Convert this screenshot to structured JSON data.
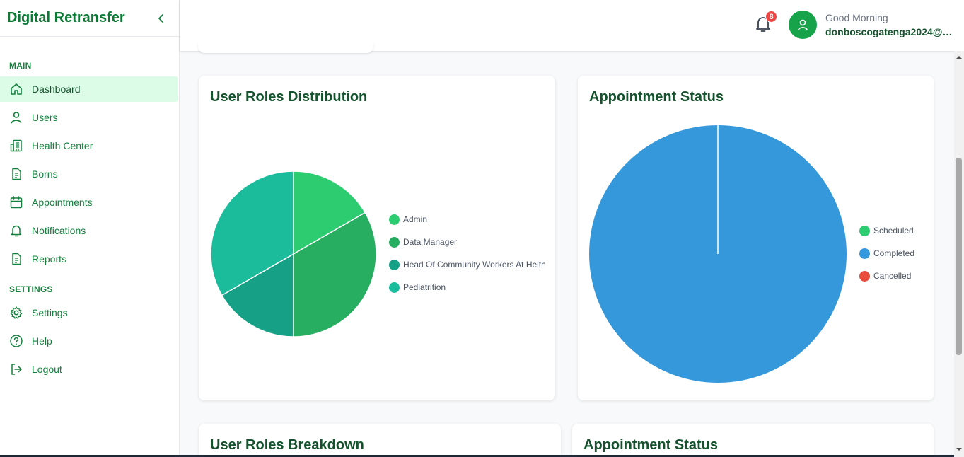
{
  "app": {
    "title": "Digital Retransfer"
  },
  "sidebar": {
    "sections": {
      "main": "MAIN",
      "settings": "SETTINGS"
    },
    "items": [
      {
        "label": "Dashboard",
        "icon": "home-icon"
      },
      {
        "label": "Users",
        "icon": "user-icon"
      },
      {
        "label": "Health Center",
        "icon": "building-icon"
      },
      {
        "label": "Borns",
        "icon": "document-icon"
      },
      {
        "label": "Appointments",
        "icon": "calendar-icon"
      },
      {
        "label": "Notifications",
        "icon": "bell-icon"
      },
      {
        "label": "Reports",
        "icon": "document-icon"
      }
    ],
    "settings_items": [
      {
        "label": "Settings",
        "icon": "gear-icon"
      },
      {
        "label": "Help",
        "icon": "help-circle-icon"
      },
      {
        "label": "Logout",
        "icon": "logout-icon"
      }
    ]
  },
  "header": {
    "notification_count": "8",
    "greeting": "Good Morning",
    "user_email": "donboscogatenga2024@g..."
  },
  "colors": {
    "brand": "#0b7a34",
    "active_bg": "#dcfce7",
    "badge": "#ef4444"
  },
  "cards": {
    "roles_title": "User Roles Distribution",
    "appointments_title": "Appointment Status",
    "breakdown_title": "User Roles Breakdown",
    "appointments_title_2": "Appointment Status"
  },
  "chart_data": [
    {
      "type": "pie",
      "title": "User Roles Distribution",
      "categories": [
        "Admin",
        "Data Manager",
        "Head Of Community Workers At Helth Center",
        "Pediatrition"
      ],
      "values": [
        1,
        2,
        1,
        2
      ],
      "colors": [
        "#2ecc71",
        "#27ae60",
        "#16a085",
        "#1abc9c"
      ],
      "legend": "right"
    },
    {
      "type": "pie",
      "title": "Appointment Status",
      "categories": [
        "Scheduled",
        "Completed",
        "Cancelled"
      ],
      "values": [
        0,
        1,
        0
      ],
      "colors": [
        "#2ecc71",
        "#3498db",
        "#e74c3c"
      ],
      "legend": "right"
    }
  ]
}
